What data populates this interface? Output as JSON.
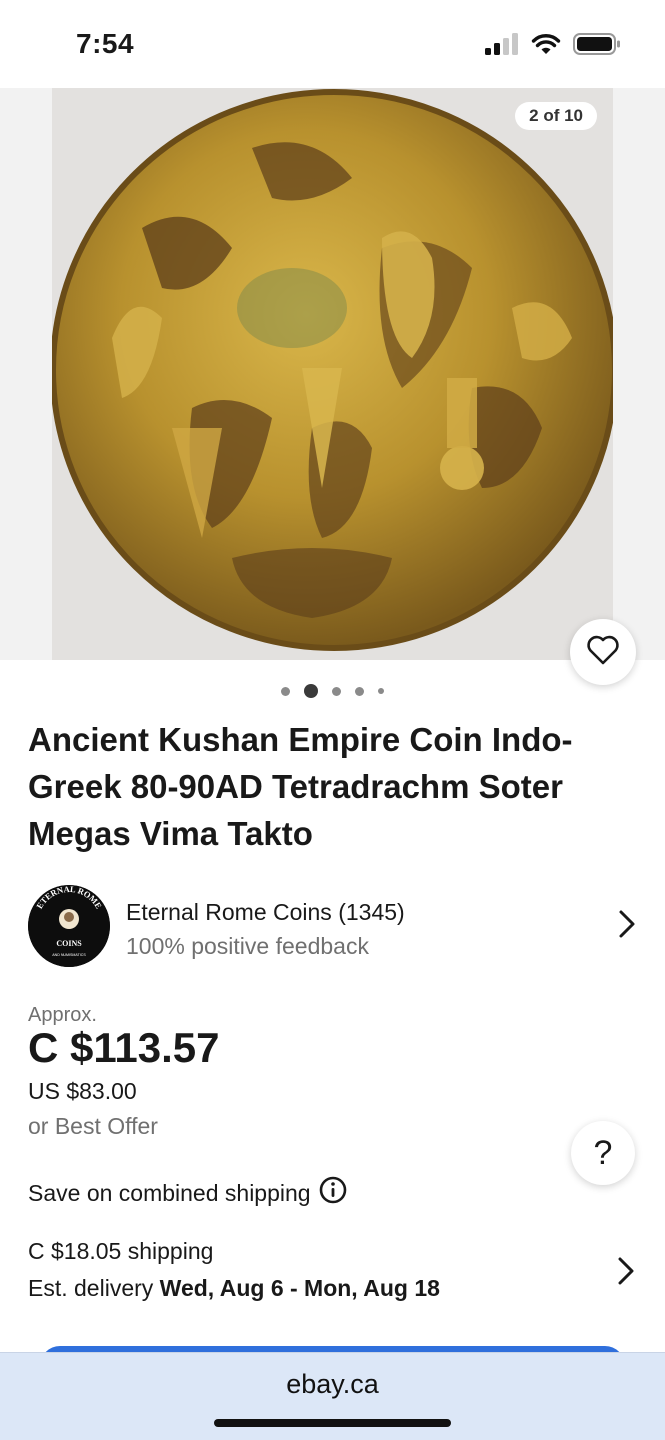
{
  "status_bar": {
    "time": "7:54",
    "icons": [
      "signal-icon",
      "wifi-icon",
      "battery-icon"
    ]
  },
  "gallery": {
    "counter": "2 of 10",
    "dots_total": 5,
    "active_dot": 2
  },
  "listing": {
    "title": "Ancient Kushan Empire Coin Indo-Greek 80-90AD Tetradrachm Soter Megas Vima Takto"
  },
  "seller": {
    "name": "Eternal Rome Coins (1345)",
    "feedback": "100% positive feedback",
    "avatar_text_top": "ETERNAL ROME",
    "avatar_text_mid": "COINS",
    "avatar_text_bottom": "AND NUMISMATICS"
  },
  "price": {
    "approx_label": "Approx.",
    "main": "C $113.57",
    "us": "US $83.00",
    "offer": "or Best Offer"
  },
  "combined_shipping": {
    "label": "Save on combined shipping"
  },
  "shipping": {
    "cost": "C $18.05 shipping",
    "delivery_prefix": "Est. delivery ",
    "delivery_dates": "Wed, Aug 6 - Mon, Aug 18"
  },
  "help": {
    "label": "?"
  },
  "browser": {
    "url": "ebay.ca"
  },
  "colors": {
    "accent_blue": "#2f6fdc",
    "url_bar": "#dce7f7",
    "coin_gold": "#c9a43a"
  }
}
